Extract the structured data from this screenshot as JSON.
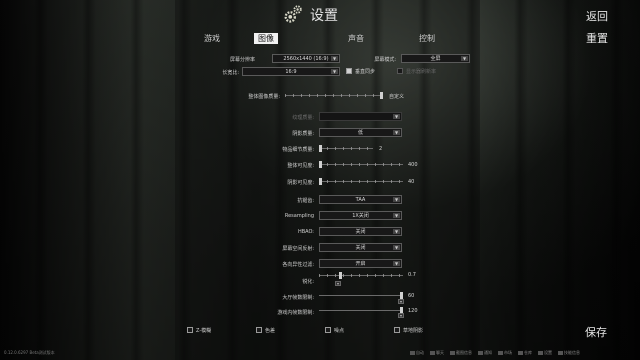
{
  "header": {
    "title": "设置"
  },
  "tabs": [
    {
      "label": "游戏"
    },
    {
      "label": "图像"
    },
    {
      "label": "声音"
    },
    {
      "label": "控制"
    }
  ],
  "actions": {
    "back": "返回",
    "reset": "重置",
    "save": "保存"
  },
  "display": {
    "resolution_label": "屏幕分辨率",
    "resolution_value": "2560x1440 (16:9)",
    "aspect_label": "长宽比:",
    "aspect_value": "16:9",
    "screen_mode_label": "屏幕模式:",
    "screen_mode_value": "全屏",
    "vsync_label": "垂直同步",
    "vsync_checked": true,
    "monitor_label": "显示器刷新率",
    "overall_quality_label": "整体图像质量:",
    "overall_quality_value": "自定义"
  },
  "settings": {
    "texture_quality": {
      "label": "纹理质量:",
      "value": ""
    },
    "shadow_quality": {
      "label": "阴影质量:",
      "value": "低"
    },
    "object_lod": {
      "label": "物品细节质量:",
      "value": "2"
    },
    "overall_visibility": {
      "label": "整体可见度:",
      "value": "400"
    },
    "shadow_visibility": {
      "label": "阴影可见度:",
      "value": "40"
    },
    "antialiasing": {
      "label": "抗锯齿:",
      "value": "TAA"
    },
    "resampling": {
      "label": "Resampling",
      "value": "1X关闭"
    },
    "hbao": {
      "label": "HBAO:",
      "value": "关闭"
    },
    "ssr": {
      "label": "屏幕空间反射:",
      "value": "关闭"
    },
    "anisotropic": {
      "label": "各向异性过滤:",
      "value": "开启"
    },
    "sharpness": {
      "label": "锐化:",
      "value": "0.7"
    },
    "lobby_fps": {
      "label": "大厅帧数限制:",
      "value": "60"
    },
    "game_fps": {
      "label": "游戏内帧数限制:",
      "value": "120"
    }
  },
  "slider_levels": {
    "object_lod": 0.0,
    "overall_visibility": 0.0,
    "shadow_visibility": 0.0,
    "sharpness": 0.25,
    "lobby_fps": 1.0,
    "game_fps": 1.0
  },
  "checkboxes": [
    {
      "label": "Z-模糊",
      "checked": false
    },
    {
      "label": "色差",
      "checked": false
    },
    {
      "label": "噪点",
      "checked": false
    },
    {
      "label": "草地阴影",
      "checked": false
    }
  ],
  "footer": {
    "version": "0.12.0.6297 Beta测试版本"
  },
  "taskbar": [
    {
      "label": "自动"
    },
    {
      "label": "聊天"
    },
    {
      "label": "截图信息"
    },
    {
      "label": "通知"
    },
    {
      "label": "市场"
    },
    {
      "label": "仓库"
    },
    {
      "label": "设置"
    },
    {
      "label": "技能信息"
    }
  ]
}
